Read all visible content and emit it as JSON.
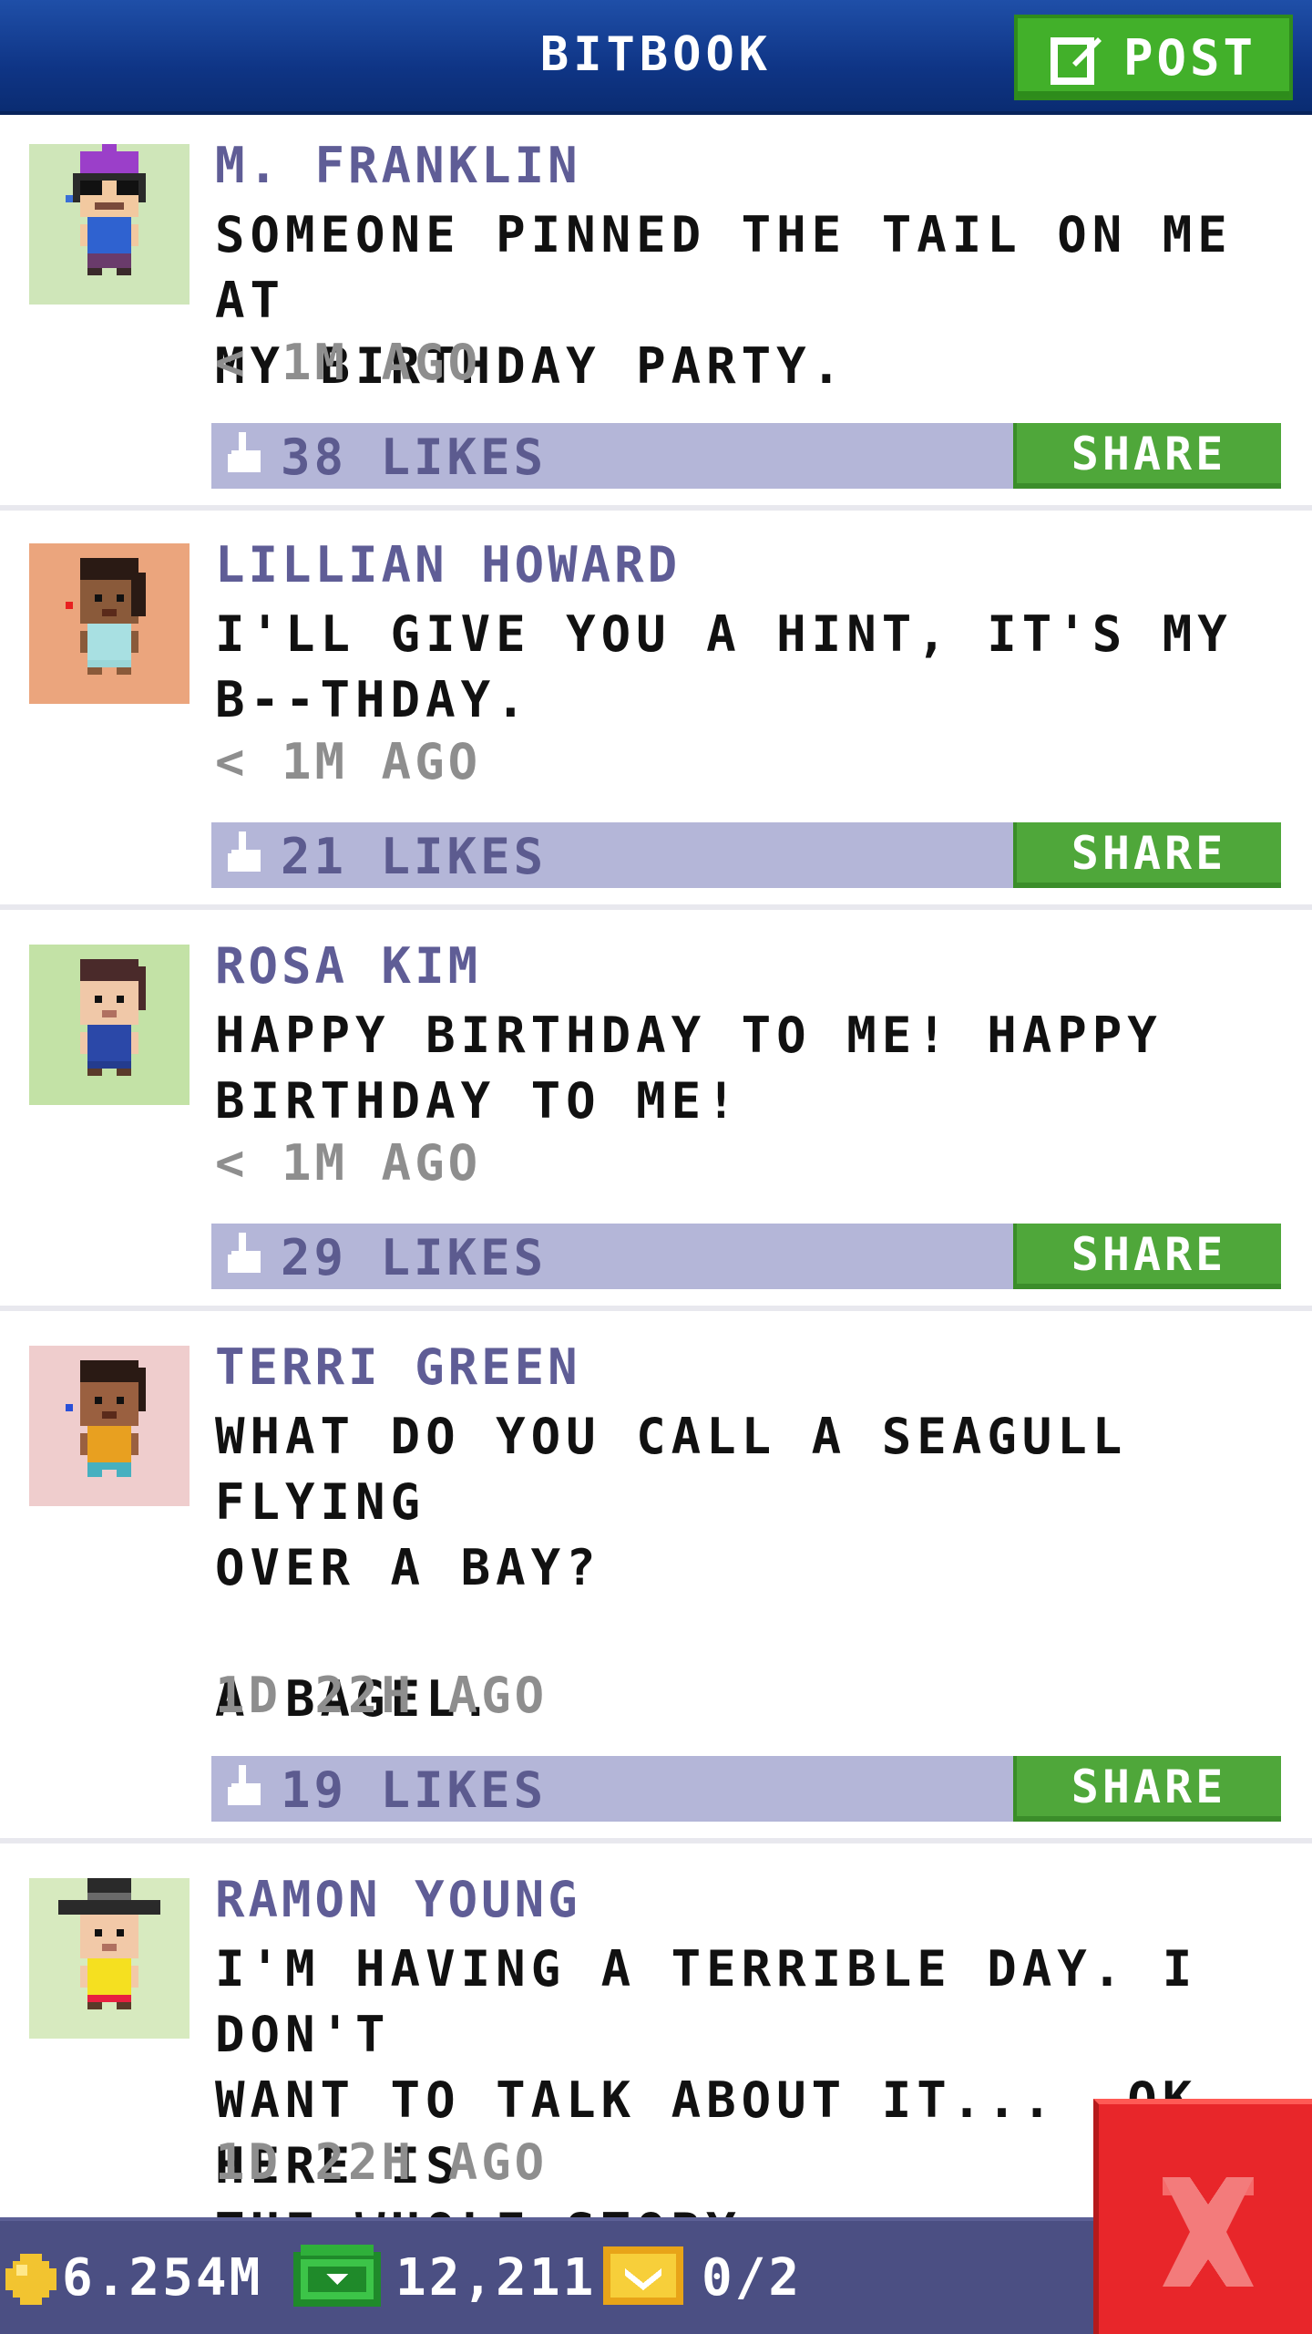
{
  "header": {
    "title": "BITBOOK",
    "post_label": "POST"
  },
  "posts": [
    {
      "name": "M. FRANKLIN",
      "text": "SOMEONE PINNED THE TAIL ON ME AT\nMY BIRTHDAY PARTY.",
      "time": "< 1M AGO",
      "likes": "38 LIKES",
      "share_label": "SHARE",
      "avatar_bg": "#cfe6b9"
    },
    {
      "name": "LILLIAN HOWARD",
      "text": "I'LL GIVE YOU A HINT, IT'S MY\nB--THDAY.",
      "time": "< 1M AGO",
      "likes": "21 LIKES",
      "share_label": "SHARE",
      "avatar_bg": "#eba57d"
    },
    {
      "name": "ROSA KIM",
      "text": "HAPPY BIRTHDAY TO ME! HAPPY\nBIRTHDAY TO ME!",
      "time": "< 1M AGO",
      "likes": "29 LIKES",
      "share_label": "SHARE",
      "avatar_bg": "#c3e2a6"
    },
    {
      "name": "TERRI GREEN",
      "text": "WHAT DO YOU CALL A SEAGULL FLYING\nOVER A BAY?\n\nA BAGEL.",
      "time": "1D 22H AGO",
      "likes": "19 LIKES",
      "share_label": "SHARE",
      "avatar_bg": "#efcdcd"
    },
    {
      "name": "RAMON YOUNG",
      "text": "I'M HAVING A TERRIBLE DAY. I DON'T\nWANT TO TALK ABOUT IT...  OK HERE IS\nTHE WHOLE STORY:",
      "time": "1D 22H AGO",
      "likes": "",
      "share_label": "",
      "avatar_bg": "#d7eabf"
    }
  ],
  "footer": {
    "coins": "6.254M",
    "bux": "12,211",
    "tickets": "0/2"
  },
  "colors": {
    "header_blue": "#0f3586",
    "post_green": "#42b02a",
    "like_bar": "#b4b6d8",
    "name_purple": "#5f5d96",
    "close_red": "#e8262a"
  },
  "icons": [
    "edit-icon",
    "thumbs-up-icon",
    "coin-icon",
    "bux-icon",
    "ticket-icon",
    "close-icon"
  ]
}
